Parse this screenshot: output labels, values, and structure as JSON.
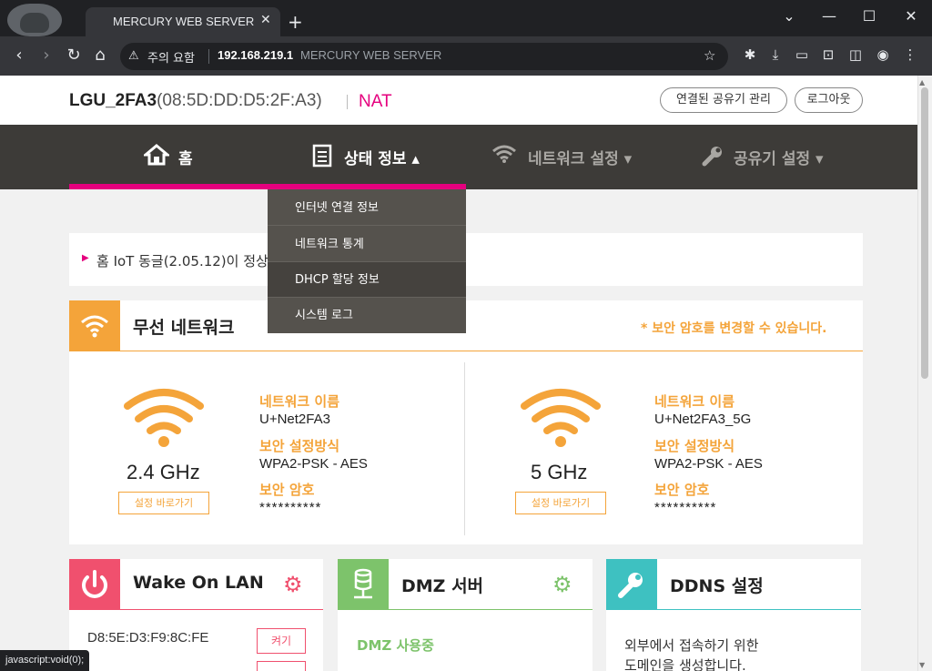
{
  "browser": {
    "tab_title": "MERCURY WEB SERVER",
    "tab_close": "✕",
    "new_tab": "+",
    "security_label": "주의 요함",
    "url_host": "192.168.219.1",
    "url_title": "MERCURY WEB SERVER",
    "status_tip": "javascript:void(0);"
  },
  "header": {
    "device_name": "LGU_2FA3",
    "device_mac": "(08:5D:DD:D5:2F:A3)",
    "mode": "NAT",
    "manage_button": "연결된 공유기 관리",
    "logout_button": "로그아웃"
  },
  "nav": {
    "home": "홈",
    "status": "상태 정보 ▴",
    "network": "네트워크 설정 ▾",
    "router": "공유기 설정 ▾"
  },
  "dropdown": {
    "items": [
      "인터넷 연결 정보",
      "네트워크 통계",
      "DHCP 할당 정보",
      "시스템 로그"
    ]
  },
  "notice": {
    "text": "홈 IoT 동글(2.05.12)이 정상"
  },
  "wireless": {
    "title": "무선 네트워크",
    "note": "* 보안 암호를 변경할 수 있습니다.",
    "bands": [
      {
        "freq": "2.4 GHz",
        "button": "설정 바로가기",
        "name_label": "네트워크 이름",
        "name_value": "U+Net2FA3",
        "security_label": "보안 설정방식",
        "security_value": "WPA2-PSK - AES",
        "password_label": "보안 암호",
        "password_value": "**********"
      },
      {
        "freq": "5 GHz",
        "button": "설정 바로가기",
        "name_label": "네트워크 이름",
        "name_value": "U+Net2FA3_5G",
        "security_label": "보안 설정방식",
        "security_value": "WPA2-PSK - AES",
        "password_label": "보안 암호",
        "password_value": "**********"
      }
    ]
  },
  "wol": {
    "title": "Wake On LAN",
    "mac": "D8:5E:D3:F9:8C:FE",
    "button": "켜기"
  },
  "dmz": {
    "title": "DMZ 서버",
    "status": "DMZ 사용중"
  },
  "ddns": {
    "title": "DDNS 설정",
    "desc_line1": "외부에서 접속하기 위한",
    "desc_line2": "도메인을 생성합니다."
  },
  "colors": {
    "accent_pink": "#e5007e",
    "wifi_orange": "#f4a43a",
    "wol_red": "#f0506e",
    "dmz_green": "#7dc36b",
    "ddns_teal": "#3ec1c1",
    "navbar": "#3d3b38"
  }
}
